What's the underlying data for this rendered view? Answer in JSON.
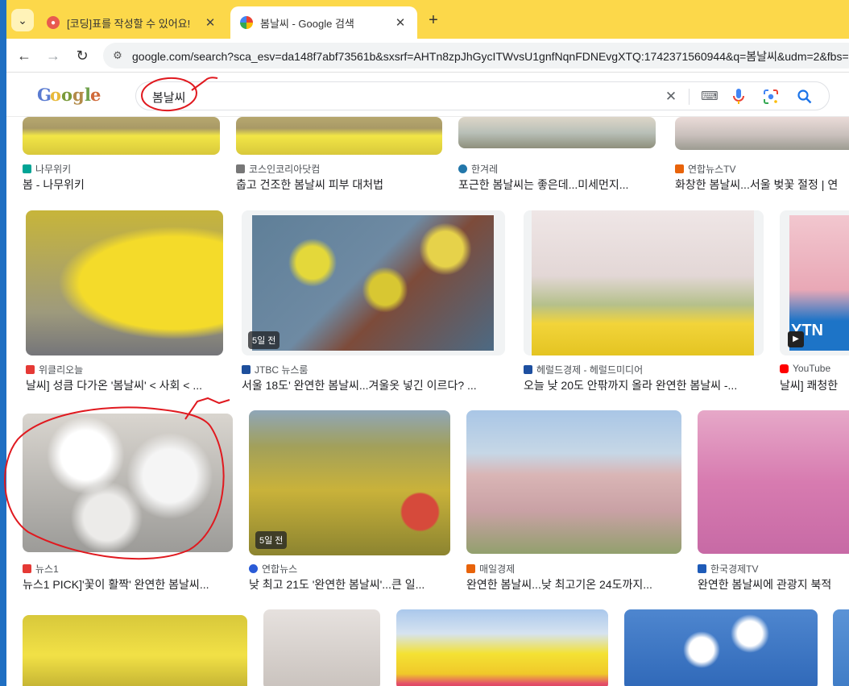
{
  "browser": {
    "tabs": [
      {
        "title": "[코딩]표를 작성할 수 있어요!",
        "active": false,
        "favicon": "red-circle-icon"
      },
      {
        "title": "봄날씨 - Google 검색",
        "active": true,
        "favicon": "google-g-icon"
      }
    ],
    "new_tab": "+",
    "url": "google.com/search?sca_esv=da148f7abf73561b&sxsrf=AHTn8zpJhGycITWvsU1gnfNqnFDNEvgXTQ:1742371560944&q=봄날씨&udm=2&fbs="
  },
  "google": {
    "logo_letters": [
      "G",
      "o",
      "o",
      "g",
      "l",
      "e"
    ],
    "query": "봄날씨"
  },
  "results": [
    {
      "source": "나무위키",
      "caption": "봄 - 나무위키"
    },
    {
      "source": "코스인코리아닷컴",
      "caption": "춥고 건조한 봄날씨 피부 대처법"
    },
    {
      "source": "한겨레",
      "caption": "포근한 봄날씨는 좋은데...미세먼지..."
    },
    {
      "source": "연합뉴스TV",
      "caption": "화창한 봄날씨...서울 벚꽃 절정 | 연"
    },
    {
      "source": "위클리오늘",
      "caption": "날씨] 성큼 다가온 '봄날씨' < 사회 < ..."
    },
    {
      "source": "JTBC 뉴스룸",
      "caption": "서울 18도' 완연한 봄날씨...겨울옷 넣긴 이르다? ...",
      "badge": "5일 전"
    },
    {
      "source": "헤럴드경제 - 헤럴드미디어",
      "caption": "오늘 낮 20도 안팎까지 올라 완연한 봄날씨 -..."
    },
    {
      "source": "YouTube",
      "caption": "날씨] 쾌청한",
      "overlay": "YTN"
    },
    {
      "source": "뉴스1",
      "caption": "뉴스1 PICK]'꽃이 활짝' 완연한 봄날씨..."
    },
    {
      "source": "연합뉴스",
      "caption": "낮 최고 21도 '완연한 봄날씨'...큰 일...",
      "badge": "5일 전"
    },
    {
      "source": "매일경제",
      "caption": "완연한 봄날씨...낮 최고기온 24도까지..."
    },
    {
      "source": "한국경제TV",
      "caption": "완연한 봄날씨에 관광지 북적"
    }
  ],
  "colors": {
    "tabstrip": "#fcd84a",
    "annotation": "#e0191f",
    "link_blue": "#1a73e8"
  }
}
